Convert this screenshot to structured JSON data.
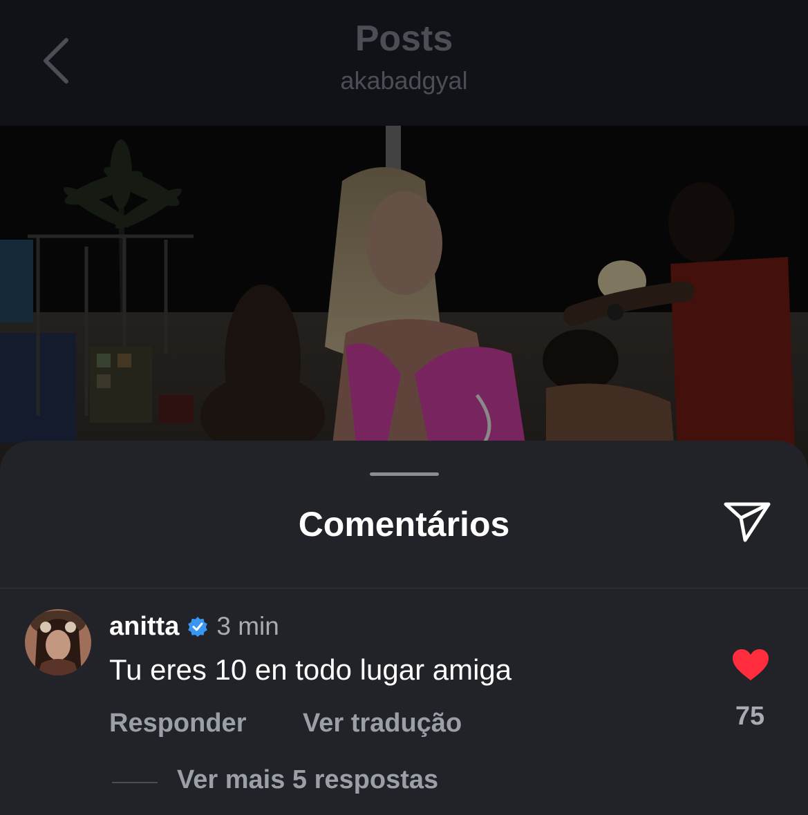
{
  "header": {
    "title": "Posts",
    "subtitle": "akabadgyal"
  },
  "sheet": {
    "title": "Comentários"
  },
  "comment": {
    "username": "anitta",
    "time": "3 min",
    "text": "Tu eres 10 en todo lugar amiga",
    "reply_label": "Responder",
    "translate_label": "Ver tradução",
    "likes": "75",
    "more_replies_label": "Ver mais 5 respostas",
    "liked": true
  },
  "icons": {
    "back": "chevron-left-icon",
    "share": "send-icon",
    "verified": "verified-badge-icon",
    "like": "heart-icon"
  },
  "colors": {
    "heart": "#ff2d3d",
    "verified": "#3897f0",
    "sheet_bg": "#212329",
    "header_bg": "#101217"
  }
}
